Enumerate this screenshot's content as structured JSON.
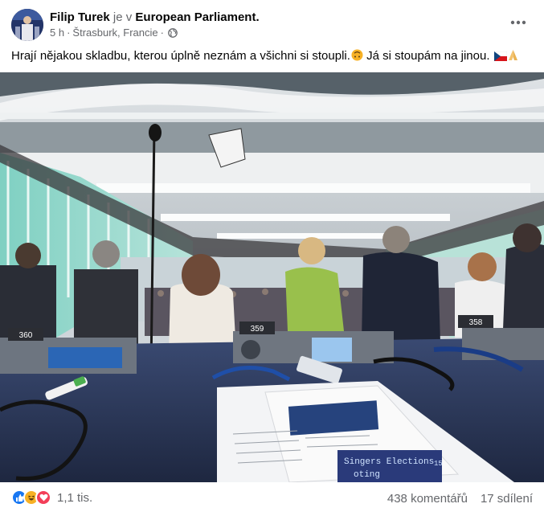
{
  "post": {
    "author": "Filip Turek",
    "joiner": "je v",
    "place": "European Parliament.",
    "time": "5 h",
    "separator": "·",
    "location": "Štrasburk, Francie",
    "separator2": "·",
    "audience_icon": "globe-icon",
    "text": "Hrají nějakou skladbu, kterou úplně neznám a všichni si stoupli.",
    "text2": "Já si stoupám na jinou.",
    "emojis": [
      "upside-down-face-emoji",
      "czech-flag-emoji",
      "folded-hands-emoji"
    ]
  },
  "photo": {
    "seat_numbers": [
      "360",
      "359",
      "358"
    ],
    "screen_text_1": "Singers Elections",
    "screen_text_2": "oting",
    "screen_number": "15"
  },
  "footer": {
    "reaction_icons": [
      "like-icon",
      "haha-icon",
      "love-icon"
    ],
    "reaction_count": "1,1 tis.",
    "comments": "438 komentářů",
    "shares": "17 sdílení"
  },
  "colors": {
    "secondary_text": "#65676b",
    "like_blue": "#1877f2",
    "love_red": "#f33e58",
    "haha_yellow": "#f7b125"
  }
}
